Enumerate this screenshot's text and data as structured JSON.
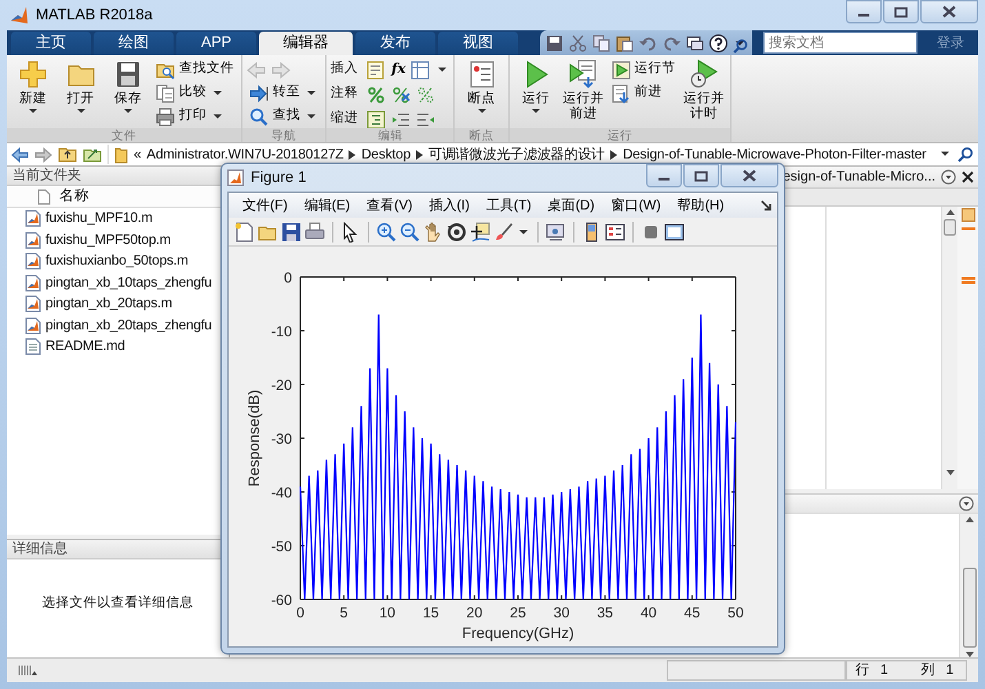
{
  "window": {
    "title": "MATLAB R2018a"
  },
  "tabs": [
    {
      "label": "主页",
      "selected": false
    },
    {
      "label": "绘图",
      "selected": false
    },
    {
      "label": "APP",
      "selected": false
    },
    {
      "label": "编辑器",
      "selected": true
    },
    {
      "label": "发布",
      "selected": false
    },
    {
      "label": "视图",
      "selected": false
    }
  ],
  "search": {
    "placeholder": "搜索文档"
  },
  "login": "登录",
  "ribbon": [
    {
      "label": "文件",
      "items": [
        {
          "kind": "large",
          "label": "新建",
          "dropdown": true
        },
        {
          "kind": "large",
          "label": "打开",
          "dropdown": true
        },
        {
          "kind": "large",
          "label": "保存",
          "dropdown": true
        },
        {
          "kind": "small",
          "label": "查找文件",
          "dropdown": false
        },
        {
          "kind": "small",
          "label": "比较",
          "dropdown": true
        },
        {
          "kind": "small",
          "label": "打印",
          "dropdown": true
        }
      ]
    },
    {
      "label": "导航",
      "items": [
        {
          "kind": "arrows",
          "disabled": true
        },
        {
          "kind": "small",
          "label": "转至",
          "dropdown": true
        },
        {
          "kind": "small",
          "label": "查找",
          "dropdown": true
        }
      ]
    },
    {
      "label": "编辑",
      "items": [
        {
          "kind": "row",
          "label": "插入",
          "symbol": "fx",
          "dropdown": true
        },
        {
          "kind": "row",
          "label": "注释",
          "dropdown": false
        },
        {
          "kind": "row",
          "label": "缩进",
          "dropdown": false
        }
      ]
    },
    {
      "label": "断点",
      "items": [
        {
          "kind": "large",
          "label": "断点",
          "dropdown": true
        }
      ]
    },
    {
      "label": "运行",
      "items": [
        {
          "kind": "large",
          "label": "运行",
          "dropdown": true
        },
        {
          "kind": "large",
          "label": "运行并前进",
          "dropdown": false
        },
        {
          "kind": "small",
          "label": "运行节",
          "dropdown": false
        },
        {
          "kind": "small",
          "label": "前进",
          "dropdown": false
        },
        {
          "kind": "large",
          "label": "运行并计时",
          "dropdown": false
        }
      ]
    }
  ],
  "address": {
    "overflow": "«",
    "segments": [
      "Administrator.WIN7U-20180127Z",
      "Desktop",
      "可调谐微波光子滤波器的设计",
      "Design-of-Tunable-Microwave-Photon-Filter-master"
    ]
  },
  "files_panel": {
    "title": "当前文件夹",
    "column": "名称",
    "files": [
      {
        "name": "fuxishu_MPF10.m",
        "kind": "m"
      },
      {
        "name": "fuxishu_MPF50top.m",
        "kind": "m"
      },
      {
        "name": "fuxishuxianbo_50tops.m",
        "kind": "m"
      },
      {
        "name": "pingtan_xb_10taps_zhengfu",
        "kind": "m"
      },
      {
        "name": "pingtan_xb_20taps.m",
        "kind": "m"
      },
      {
        "name": "pingtan_xb_20taps_zhengfu",
        "kind": "m"
      },
      {
        "name": "README.md",
        "kind": "text"
      }
    ]
  },
  "details": {
    "title": "详细信息",
    "message": "选择文件以查看详细信息"
  },
  "editor": {
    "tab": "esign-of-Tunable-Micro..."
  },
  "figure": {
    "title": "Figure 1",
    "menu": [
      "文件(F)",
      "编辑(E)",
      "查看(V)",
      "插入(I)",
      "工具(T)",
      "桌面(D)",
      "窗口(W)",
      "帮助(H)"
    ],
    "chart_data": {
      "type": "line",
      "xlabel": "Frequency(GHz)",
      "ylabel": "Response(dB)",
      "xlim": [
        0,
        50
      ],
      "ylim": [
        -60,
        0
      ],
      "xticks": [
        0,
        5,
        10,
        15,
        20,
        25,
        30,
        35,
        40,
        45,
        50
      ],
      "yticks": [
        -60,
        -50,
        -40,
        -30,
        -20,
        -10,
        0
      ],
      "x": [
        0,
        0.5,
        1,
        1.5,
        2,
        2.5,
        3,
        3.5,
        4,
        4.5,
        5,
        5.5,
        6,
        6.5,
        7,
        7.5,
        8,
        8.5,
        9,
        9.5,
        10,
        10.5,
        11,
        11.5,
        12,
        12.5,
        13,
        13.5,
        14,
        14.5,
        15,
        15.5,
        16,
        16.5,
        17,
        17.5,
        18,
        18.5,
        19,
        19.5,
        20,
        20.5,
        21,
        21.5,
        22,
        22.5,
        23,
        23.5,
        24,
        24.5,
        25,
        25.5,
        26,
        26.5,
        27,
        27.5,
        28,
        28.5,
        29,
        29.5,
        30,
        30.5,
        31,
        31.5,
        32,
        32.5,
        33,
        33.5,
        34,
        34.5,
        35,
        35.5,
        36,
        36.5,
        37,
        37.5,
        38,
        38.5,
        39,
        39.5,
        40,
        40.5,
        41,
        41.5,
        42,
        42.5,
        43,
        43.5,
        44,
        44.5,
        45,
        45.5,
        46,
        46.5,
        47,
        47.5,
        48,
        48.5,
        49,
        49.5,
        50
      ],
      "series": [
        {
          "color": "#0000ff",
          "values": [
            -39,
            -60,
            -37,
            -60,
            -36,
            -60,
            -34,
            -60,
            -33,
            -60,
            -31,
            -60,
            -28,
            -60,
            -24,
            -60,
            -17,
            -60,
            -7,
            -60,
            -17,
            -60,
            -22,
            -60,
            -25,
            -60,
            -28,
            -60,
            -30,
            -60,
            -31,
            -60,
            -33,
            -60,
            -34,
            -60,
            -35,
            -60,
            -36,
            -60,
            -37,
            -60,
            -38,
            -60,
            -39,
            -60,
            -39.5,
            -60,
            -40,
            -60,
            -40.5,
            -60,
            -41,
            -60,
            -41,
            -60,
            -41,
            -60,
            -40.5,
            -60,
            -40,
            -60,
            -39.5,
            -60,
            -39,
            -60,
            -38,
            -60,
            -37.5,
            -60,
            -37,
            -60,
            -36,
            -60,
            -35,
            -60,
            -33,
            -60,
            -32,
            -60,
            -30,
            -60,
            -28,
            -60,
            -25,
            -60,
            -22,
            -60,
            -19,
            -60,
            -15,
            -60,
            -7,
            -60,
            -16,
            -60,
            -20,
            -60,
            -24,
            -60,
            -27
          ]
        }
      ]
    }
  },
  "status_bar": {
    "row_label": "行",
    "row": "1",
    "column_label": "列",
    "column": "1"
  }
}
